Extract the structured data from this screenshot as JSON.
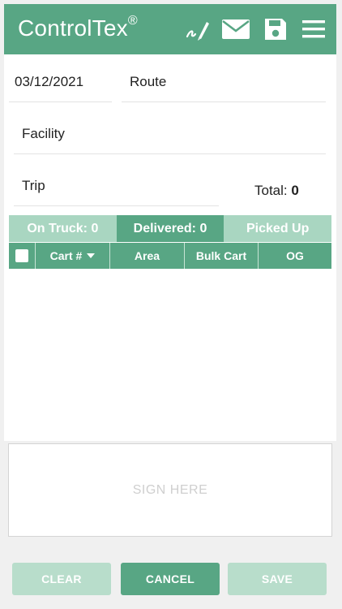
{
  "header": {
    "brand": "ControlTex",
    "brand_mark": "®",
    "icons": [
      "signature-icon",
      "mail-icon",
      "save-icon",
      "menu-icon"
    ]
  },
  "form": {
    "date": "03/12/2021",
    "route_placeholder": "Route",
    "facility_placeholder": "Facility",
    "trip_placeholder": "Trip",
    "total_label": "Total:",
    "total_value": "0"
  },
  "tabs": [
    {
      "label": "On Truck: 0",
      "active": false
    },
    {
      "label": "Delivered: 0",
      "active": true
    },
    {
      "label": "Picked Up",
      "active": false
    }
  ],
  "table": {
    "columns": [
      "Cart #",
      "Area",
      "Bulk Cart",
      "OG"
    ],
    "rows": []
  },
  "signature": {
    "placeholder": "SIGN HERE"
  },
  "actions": {
    "clear": "CLEAR",
    "cancel": "CANCEL",
    "save": "SAVE"
  },
  "colors": {
    "primary": "#58a684",
    "primary_light": "#a9d6c1",
    "disabled": "#b8ddcb"
  }
}
